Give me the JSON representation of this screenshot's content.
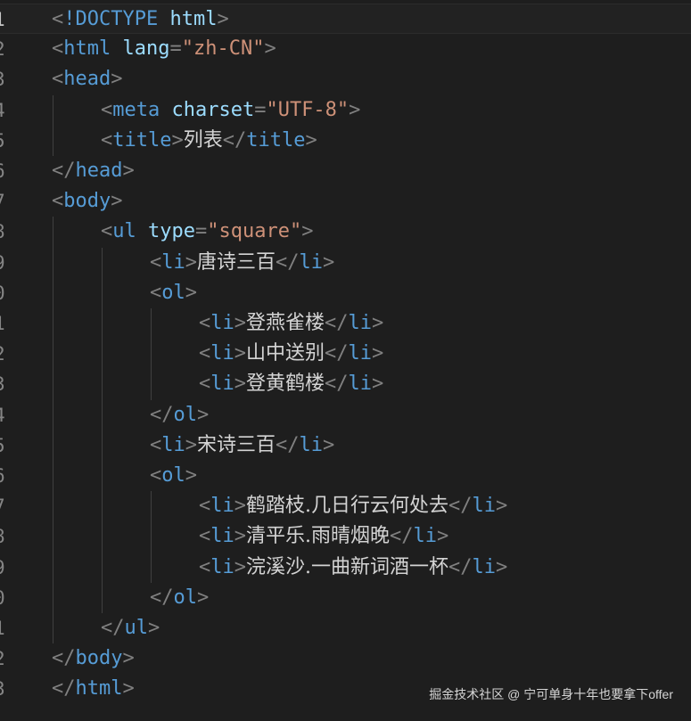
{
  "editor": {
    "language": "html",
    "line_numbers": [
      "1",
      "2",
      "3",
      "4",
      "5",
      "6",
      "7",
      "8",
      "9",
      "0",
      "1",
      "2",
      "3",
      "4",
      "5",
      "6",
      "7",
      "8",
      "9",
      "0",
      "1",
      "2",
      "3"
    ],
    "current_line": 1,
    "lines": [
      {
        "indent": 0,
        "tokens": [
          [
            "punc",
            "<"
          ],
          [
            "tag",
            "!DOCTYPE"
          ],
          [
            "punc",
            " "
          ],
          [
            "attr",
            "html"
          ],
          [
            "punc",
            ">"
          ]
        ]
      },
      {
        "indent": 0,
        "tokens": [
          [
            "punc",
            "<"
          ],
          [
            "tag",
            "html"
          ],
          [
            "punc",
            " "
          ],
          [
            "attr",
            "lang"
          ],
          [
            "punc",
            "="
          ],
          [
            "str",
            "\"zh-CN\""
          ],
          [
            "punc",
            ">"
          ]
        ]
      },
      {
        "indent": 0,
        "tokens": [
          [
            "punc",
            "<"
          ],
          [
            "tag",
            "head"
          ],
          [
            "punc",
            ">"
          ]
        ]
      },
      {
        "indent": 1,
        "tokens": [
          [
            "punc",
            "<"
          ],
          [
            "tag",
            "meta"
          ],
          [
            "punc",
            " "
          ],
          [
            "attr",
            "charset"
          ],
          [
            "punc",
            "="
          ],
          [
            "str",
            "\"UTF-8\""
          ],
          [
            "punc",
            ">"
          ]
        ]
      },
      {
        "indent": 1,
        "tokens": [
          [
            "punc",
            "<"
          ],
          [
            "tag",
            "title"
          ],
          [
            "punc",
            ">"
          ],
          [
            "text",
            "列表"
          ],
          [
            "punc",
            "</"
          ],
          [
            "tag",
            "title"
          ],
          [
            "punc",
            ">"
          ]
        ]
      },
      {
        "indent": 0,
        "tokens": [
          [
            "punc",
            "</"
          ],
          [
            "tag",
            "head"
          ],
          [
            "punc",
            ">"
          ]
        ]
      },
      {
        "indent": 0,
        "tokens": [
          [
            "punc",
            "<"
          ],
          [
            "tag",
            "body"
          ],
          [
            "punc",
            ">"
          ]
        ]
      },
      {
        "indent": 1,
        "tokens": [
          [
            "punc",
            "<"
          ],
          [
            "tag",
            "ul"
          ],
          [
            "punc",
            " "
          ],
          [
            "attr",
            "type"
          ],
          [
            "punc",
            "="
          ],
          [
            "str",
            "\"square\""
          ],
          [
            "punc",
            ">"
          ]
        ]
      },
      {
        "indent": 2,
        "tokens": [
          [
            "punc",
            "<"
          ],
          [
            "tag",
            "li"
          ],
          [
            "punc",
            ">"
          ],
          [
            "text",
            "唐诗三百"
          ],
          [
            "punc",
            "</"
          ],
          [
            "tag",
            "li"
          ],
          [
            "punc",
            ">"
          ]
        ]
      },
      {
        "indent": 2,
        "tokens": [
          [
            "punc",
            "<"
          ],
          [
            "tag",
            "ol"
          ],
          [
            "punc",
            ">"
          ]
        ]
      },
      {
        "indent": 3,
        "tokens": [
          [
            "punc",
            "<"
          ],
          [
            "tag",
            "li"
          ],
          [
            "punc",
            ">"
          ],
          [
            "text",
            "登燕雀楼"
          ],
          [
            "punc",
            "</"
          ],
          [
            "tag",
            "li"
          ],
          [
            "punc",
            ">"
          ]
        ]
      },
      {
        "indent": 3,
        "tokens": [
          [
            "punc",
            "<"
          ],
          [
            "tag",
            "li"
          ],
          [
            "punc",
            ">"
          ],
          [
            "text",
            "山中送别"
          ],
          [
            "punc",
            "</"
          ],
          [
            "tag",
            "li"
          ],
          [
            "punc",
            ">"
          ]
        ]
      },
      {
        "indent": 3,
        "tokens": [
          [
            "punc",
            "<"
          ],
          [
            "tag",
            "li"
          ],
          [
            "punc",
            ">"
          ],
          [
            "text",
            "登黄鹤楼"
          ],
          [
            "punc",
            "</"
          ],
          [
            "tag",
            "li"
          ],
          [
            "punc",
            ">"
          ]
        ]
      },
      {
        "indent": 2,
        "tokens": [
          [
            "punc",
            "</"
          ],
          [
            "tag",
            "ol"
          ],
          [
            "punc",
            ">"
          ]
        ]
      },
      {
        "indent": 2,
        "tokens": [
          [
            "punc",
            "<"
          ],
          [
            "tag",
            "li"
          ],
          [
            "punc",
            ">"
          ],
          [
            "text",
            "宋诗三百"
          ],
          [
            "punc",
            "</"
          ],
          [
            "tag",
            "li"
          ],
          [
            "punc",
            ">"
          ]
        ]
      },
      {
        "indent": 2,
        "tokens": [
          [
            "punc",
            "<"
          ],
          [
            "tag",
            "ol"
          ],
          [
            "punc",
            ">"
          ]
        ]
      },
      {
        "indent": 3,
        "tokens": [
          [
            "punc",
            "<"
          ],
          [
            "tag",
            "li"
          ],
          [
            "punc",
            ">"
          ],
          [
            "text",
            "鹤踏枝.几日行云何处去"
          ],
          [
            "punc",
            "</"
          ],
          [
            "tag",
            "li"
          ],
          [
            "punc",
            ">"
          ]
        ]
      },
      {
        "indent": 3,
        "tokens": [
          [
            "punc",
            "<"
          ],
          [
            "tag",
            "li"
          ],
          [
            "punc",
            ">"
          ],
          [
            "text",
            "清平乐.雨晴烟晚"
          ],
          [
            "punc",
            "</"
          ],
          [
            "tag",
            "li"
          ],
          [
            "punc",
            ">"
          ]
        ]
      },
      {
        "indent": 3,
        "tokens": [
          [
            "punc",
            "<"
          ],
          [
            "tag",
            "li"
          ],
          [
            "punc",
            ">"
          ],
          [
            "text",
            "浣溪沙.一曲新词酒一杯"
          ],
          [
            "punc",
            "</"
          ],
          [
            "tag",
            "li"
          ],
          [
            "punc",
            ">"
          ]
        ]
      },
      {
        "indent": 2,
        "tokens": [
          [
            "punc",
            "</"
          ],
          [
            "tag",
            "ol"
          ],
          [
            "punc",
            ">"
          ]
        ]
      },
      {
        "indent": 1,
        "tokens": [
          [
            "punc",
            "</"
          ],
          [
            "tag",
            "ul"
          ],
          [
            "punc",
            ">"
          ]
        ]
      },
      {
        "indent": 0,
        "tokens": [
          [
            "punc",
            "</"
          ],
          [
            "tag",
            "body"
          ],
          [
            "punc",
            ">"
          ]
        ]
      },
      {
        "indent": 0,
        "tokens": [
          [
            "punc",
            "</"
          ],
          [
            "tag",
            "html"
          ],
          [
            "punc",
            ">"
          ]
        ]
      }
    ],
    "colors": {
      "background": "#1e1e1e",
      "punctuation": "#808080",
      "tag": "#569cd6",
      "attribute": "#9cdcfe",
      "string": "#ce9178",
      "text": "#d4d4d4"
    }
  },
  "watermark": {
    "text": "掘金技术社区 @ 宁可单身十年也要拿下offer"
  }
}
